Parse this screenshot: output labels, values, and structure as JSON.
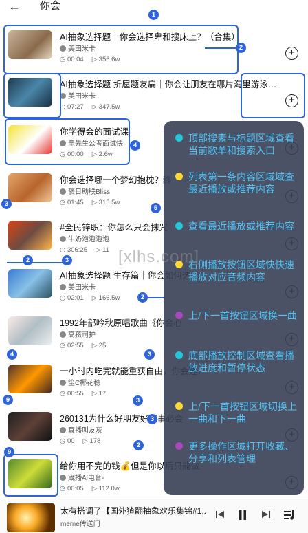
{
  "header": {
    "back_icon": "arrow-left-icon",
    "title": "你会"
  },
  "items": [
    {
      "title": "AI抽象选择题｜你会选择卑和搜床上？（合集）",
      "author": "美田米卡",
      "duration": "00:04",
      "plays": "356.6w"
    },
    {
      "title": "AI抽象选择题 折扈题友扁｜你会让朋友在哪片海里游泳？（合集）",
      "author": "美田米卡",
      "duration": "07:27",
      "plays": "347.5w"
    },
    {
      "title": "你学得会的面试课",
      "author": "垩先生公考面试快",
      "duration": "00:00",
      "plays": "2.6w"
    },
    {
      "title": "你会选择哪一个梦幻抱枕？终",
      "author": "褒日助联Bliss",
      "duration": "01:45",
      "plays": "315.5w"
    },
    {
      "title": "#全民锌职：你怎么只会抹咒",
      "author": "牛奶泡泡泡泡",
      "duration": "306:25",
      "plays": "11"
    },
    {
      "title": "AI抽象选择题 生存篇｜你会如何选择",
      "author": "美田米卡",
      "duration": "02:01",
      "plays": "166.5w"
    },
    {
      "title": "1992年部吟秋原唱歌曲《你会心",
      "author": "高孩司护",
      "duration": "02:55",
      "plays": "25"
    },
    {
      "title": "一小时内吃完就能重获自由，你会选",
      "author": "笙C椰花穂",
      "duration": "00:55",
      "plays": "17"
    },
    {
      "title": "260131为什么好朋友好同事必会",
      "author": "袞播叫友灰",
      "duration": "00",
      "plays": "178"
    },
    {
      "title": "给你用不完的钱💰但是你以后只能做",
      "author": "宬播Al电台-",
      "duration": "00:05",
      "plays": "112.0w"
    }
  ],
  "tooltip": [
    {
      "text": "顶部搜素与标题区域查看当前歌单和搜索入口",
      "dot_color": "#26c6da"
    },
    {
      "text": "列表第一条内容区域域查最近播放或推荐内容",
      "dot_color": "#fdd835"
    },
    {
      "text": "查看最近播放或推荐内容",
      "dot_color": "#26c6da"
    },
    {
      "text": "右侧播放按钮区域快快速播放对应音频内容",
      "dot_color": "#fdd835"
    },
    {
      "text": "上/下一首按钮区域换一曲",
      "dot_color": "#ab47bc"
    },
    {
      "text": "底部播放控制区域查看播放进度和暂停状态",
      "dot_color": "#26c6da"
    },
    {
      "text": "上/下一首按钮区域切换上一曲和下一曲",
      "dot_color": "#fdd835"
    },
    {
      "text": "更多操作区域打开收藏、分享和列表管理",
      "dot_color": "#ab47bc"
    }
  ],
  "markers": [
    "1",
    "2",
    "3",
    "4",
    "5",
    "3",
    "2",
    "3",
    "2",
    "4",
    "3",
    "9",
    "3",
    "2",
    "9"
  ],
  "watermark": "[xlhs.com]",
  "player": {
    "title": "太有搭调了【国外猹翻抽象欢乐集锦#1...",
    "artist": "meme传送门",
    "icons": [
      "skip-previous-icon",
      "pause-icon",
      "skip-next-icon",
      "playlist-icon"
    ]
  },
  "colors": {
    "annotation": "#2f63d8",
    "tooltip_bg": "#383f54",
    "tooltip_text": "#4fc3f7"
  }
}
